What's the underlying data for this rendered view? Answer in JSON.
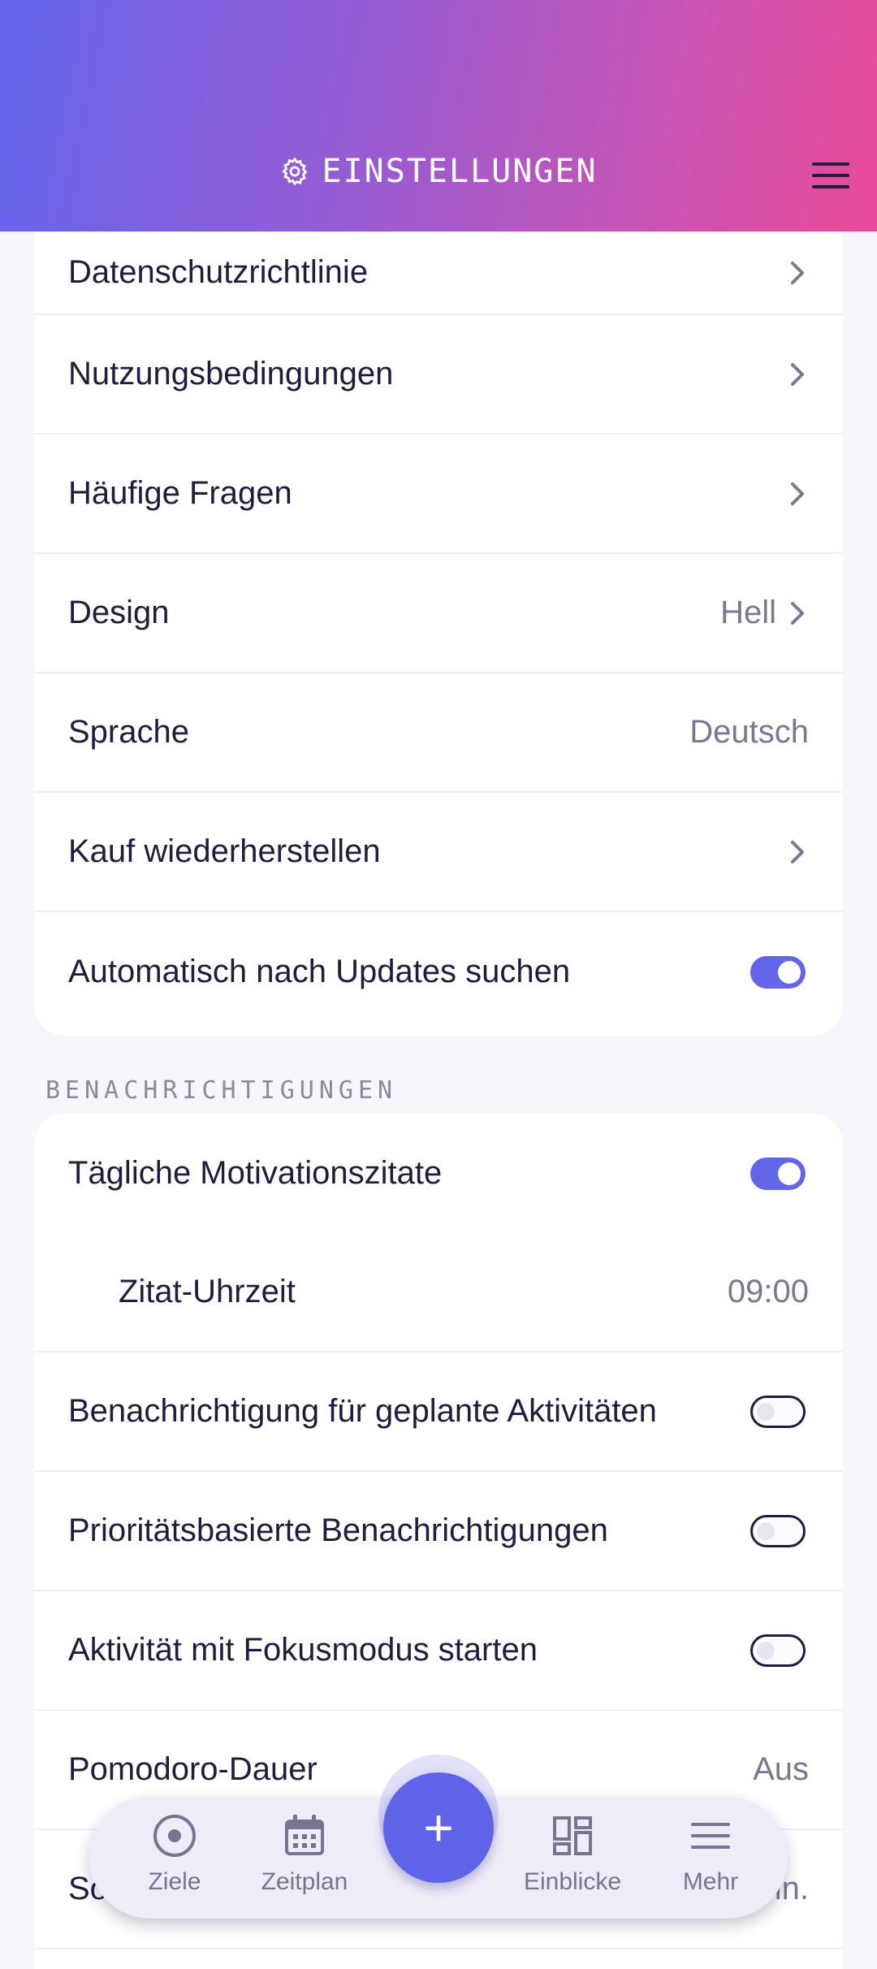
{
  "header": {
    "title": "EINSTELLUNGEN",
    "icon": "gear-icon",
    "menu_icon": "hamburger-icon"
  },
  "general_rows": [
    {
      "label": "Datenschutzrichtlinie",
      "type": "link"
    },
    {
      "label": "Nutzungsbedingungen",
      "type": "link"
    },
    {
      "label": "Häufige Fragen",
      "type": "link"
    },
    {
      "label": "Design",
      "value": "Hell",
      "type": "link"
    },
    {
      "label": "Sprache",
      "value": "Deutsch",
      "type": "value"
    },
    {
      "label": "Kauf wiederherstellen",
      "type": "link"
    },
    {
      "label": "Automatisch nach Updates suchen",
      "type": "toggle",
      "on": true
    }
  ],
  "notifications": {
    "section_title": "BENACHRICHTIGUNGEN",
    "rows": [
      {
        "label": "Tägliche Motivationszitate",
        "type": "toggle",
        "on": true
      },
      {
        "label": "Zitat-Uhrzeit",
        "value": "09:00",
        "type": "value"
      },
      {
        "label": "Benachrichtigung für geplante Aktivitäten",
        "type": "toggle",
        "on": false
      },
      {
        "label": "Prioritätsbasierte Benachrichtigungen",
        "type": "toggle",
        "on": false
      },
      {
        "label": "Aktivität mit Fokusmodus starten",
        "type": "toggle",
        "on": false
      },
      {
        "label": "Pomodoro-Dauer",
        "value": "Aus",
        "type": "value"
      },
      {
        "label": "So",
        "value": "in.",
        "type": "value"
      }
    ]
  },
  "bottom_nav": {
    "items": [
      {
        "label": "Ziele",
        "icon": "target-icon"
      },
      {
        "label": "Zeitplan",
        "icon": "calendar-icon"
      },
      {
        "label": "Einblicke",
        "icon": "dashboard-icon"
      },
      {
        "label": "Mehr",
        "icon": "menu-icon"
      }
    ],
    "fab_label": "+"
  },
  "colors": {
    "accent": "#6366e9",
    "header_gradient_start": "#6466ee",
    "header_gradient_end": "#e84a98",
    "background": "#f7f6fc"
  }
}
